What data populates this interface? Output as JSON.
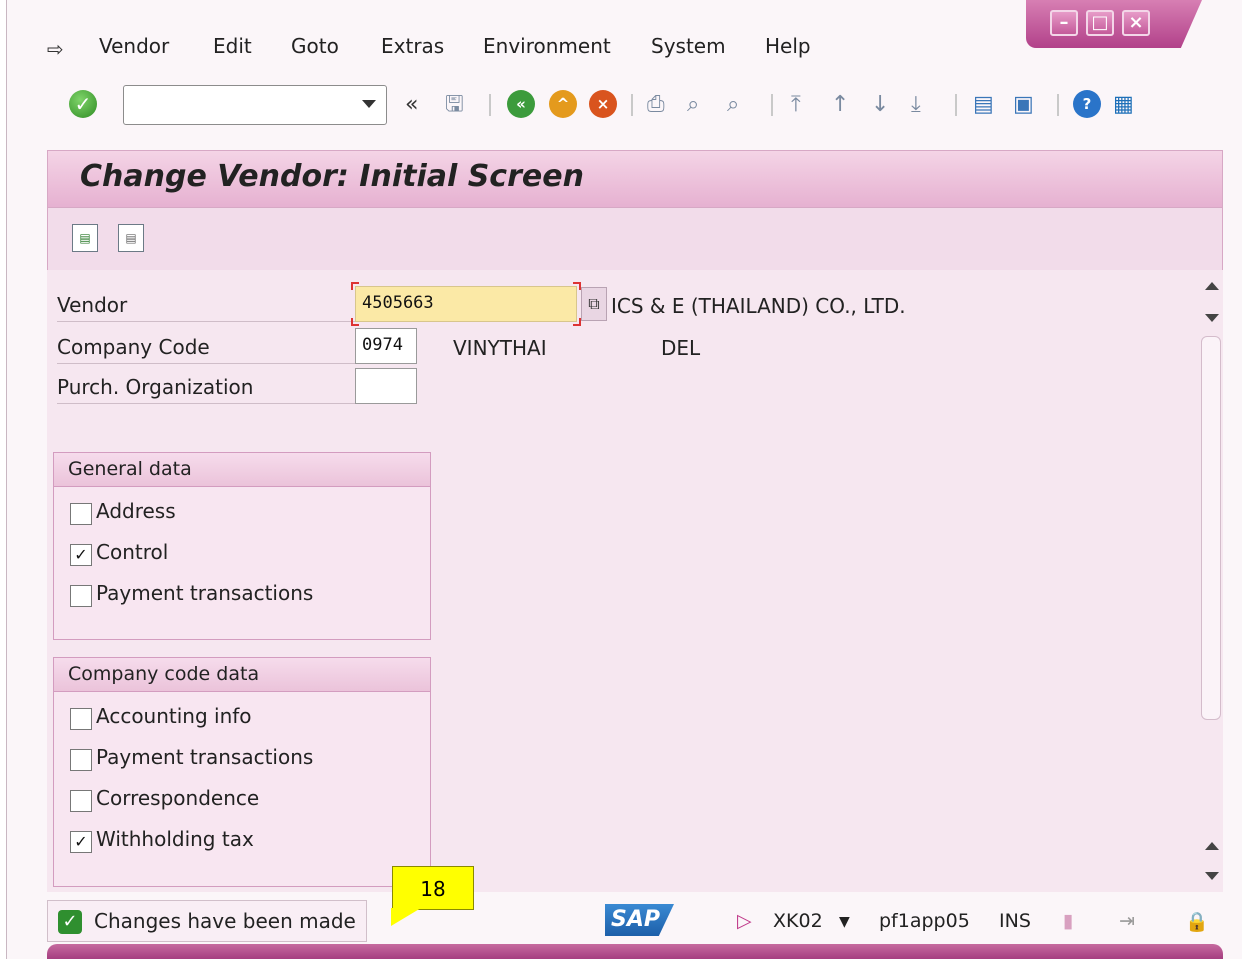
{
  "menu": {
    "items": [
      "Vendor",
      "Edit",
      "Goto",
      "Extras",
      "Environment",
      "System",
      "Help"
    ]
  },
  "toolbar": {
    "command_value": "",
    "back_label": "«"
  },
  "title": "Change Vendor: Initial Screen",
  "fields": {
    "vendor_label": "Vendor",
    "vendor_value": "4505663",
    "vendor_desc": "ICS & E (THAILAND) CO., LTD.",
    "company_label": "Company Code",
    "company_value": "0974",
    "company_name": "VINYTHAI",
    "company_status": "DEL",
    "purch_label": "Purch. Organization",
    "purch_value": ""
  },
  "general": {
    "header": "General data",
    "items": [
      {
        "label": "Address",
        "checked": false
      },
      {
        "label": "Control",
        "checked": true
      },
      {
        "label": "Payment transactions",
        "checked": false
      }
    ]
  },
  "company": {
    "header": "Company code data",
    "items": [
      {
        "label": "Accounting info",
        "checked": false
      },
      {
        "label": "Payment transactions",
        "checked": false
      },
      {
        "label": "Correspondence",
        "checked": false
      },
      {
        "label": "Withholding tax",
        "checked": true
      }
    ]
  },
  "status": {
    "message": "Changes have been made",
    "callout": "18",
    "transaction": "XK02",
    "server": "pf1app05",
    "mode": "INS",
    "logo": "SAP"
  },
  "icons": {
    "check_mark": "✓",
    "accent": "#b2418a"
  }
}
